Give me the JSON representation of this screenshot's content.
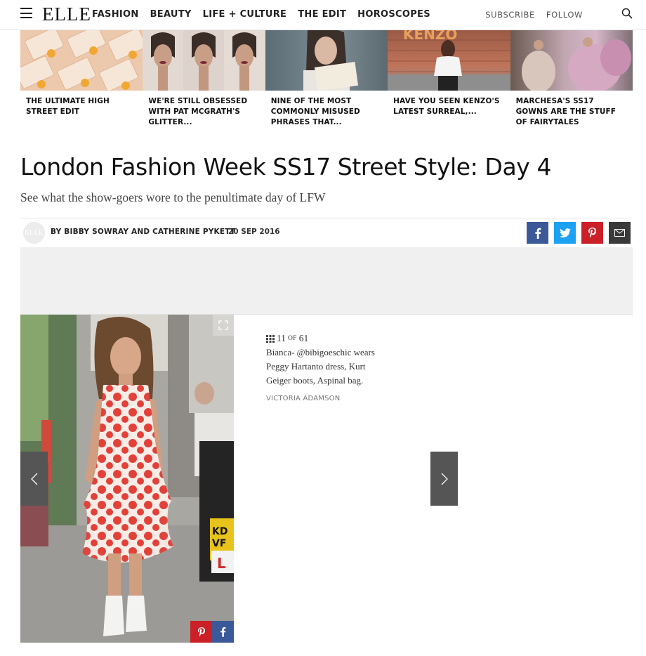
{
  "site": {
    "logo": "ELLE"
  },
  "nav": {
    "links": [
      "FASHION",
      "BEAUTY",
      "LIFE + CULTURE",
      "THE EDIT",
      "HOROSCOPES"
    ],
    "subscribe": "SUBSCRIBE",
    "follow": "FOLLOW"
  },
  "related": [
    {
      "title": "THE ULTIMATE HIGH STREET EDIT"
    },
    {
      "title": "WE'RE STILL OBSESSED WITH PAT MCGRATH'S GLITTER..."
    },
    {
      "title": "NINE OF THE MOST COMMONLY MISUSED PHRASES THAT..."
    },
    {
      "title": "HAVE YOU SEEN KENZO'S LATEST SURREAL,...",
      "thumb_text": "KENZO"
    },
    {
      "title": "MARCHESA'S SS17 GOWNS ARE THE STUFF OF FAIRYTALES"
    }
  ],
  "article": {
    "headline": "London Fashion Week SS17 Street Style: Day 4",
    "dek": "See what the show-goers wore to the penultimate day of LFW",
    "avatar_text": "ELLE",
    "byline": "BY BIBBY SOWRAY AND CATHERINE PYKETT",
    "date": "20 SEP 2016"
  },
  "share": {
    "icons": [
      "facebook-icon",
      "twitter-icon",
      "pinterest-icon",
      "email-icon"
    ],
    "colors": {
      "facebook": "#3b5998",
      "twitter": "#1da1f2",
      "pinterest": "#cb2027",
      "email": "#3a3a3a"
    }
  },
  "gallery": {
    "current": "11",
    "of_label": "OF",
    "total": "61",
    "caption": "Bianca- @bibigoeschic wears Peggy Hartanto dress, Kurt Geiger boots, Aspinal bag.",
    "credit": "VICTORIA ADAMSON",
    "photo_sign_text": [
      "KD",
      "VF",
      "L"
    ]
  }
}
